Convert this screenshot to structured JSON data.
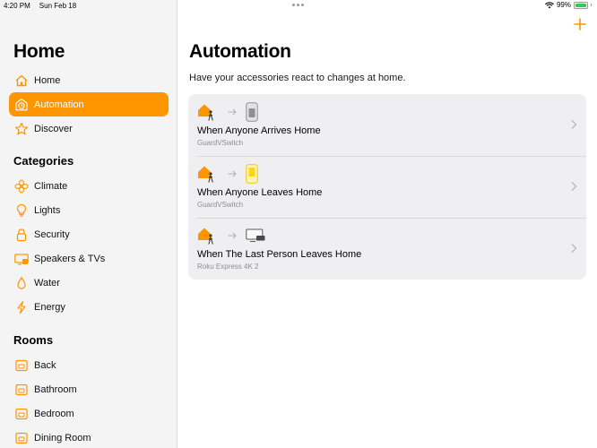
{
  "status_bar": {
    "time": "4:20 PM",
    "date": "Sun Feb 18",
    "battery": "99%"
  },
  "sidebar": {
    "title": "Home",
    "primary": [
      {
        "label": "Home",
        "icon": "house-icon",
        "selected": false
      },
      {
        "label": "Automation",
        "icon": "clock-icon",
        "selected": true
      },
      {
        "label": "Discover",
        "icon": "star-icon",
        "selected": false
      }
    ],
    "categories_header": "Categories",
    "categories": [
      {
        "label": "Climate",
        "icon": "fan-icon"
      },
      {
        "label": "Lights",
        "icon": "lightbulb-icon"
      },
      {
        "label": "Security",
        "icon": "lock-icon"
      },
      {
        "label": "Speakers & TVs",
        "icon": "tv-icon"
      },
      {
        "label": "Water",
        "icon": "drop-icon"
      },
      {
        "label": "Energy",
        "icon": "bolt-icon"
      }
    ],
    "rooms_header": "Rooms",
    "rooms": [
      {
        "label": "Back",
        "icon": "room-icon"
      },
      {
        "label": "Bathroom",
        "icon": "room-icon"
      },
      {
        "label": "Bedroom",
        "icon": "room-icon"
      },
      {
        "label": "Dining Room",
        "icon": "room-icon"
      }
    ]
  },
  "main": {
    "title": "Automation",
    "subtitle": "Have your accessories react to changes at home.",
    "automations": [
      {
        "title": "When Anyone Arrives Home",
        "subtitle": "GuardVSwitch",
        "target_icon": "switch-off-icon"
      },
      {
        "title": "When Anyone Leaves Home",
        "subtitle": "GuardVSwitch",
        "target_icon": "switch-on-icon"
      },
      {
        "title": "When The Last Person Leaves Home",
        "subtitle": "Roku Express 4K 2",
        "target_icon": "tv-box-icon"
      }
    ]
  },
  "colors": {
    "accent": "#ff9500",
    "sidebar_bg": "#f4f4f5",
    "card_bg": "#efeff2",
    "secondary_text": "#8e8e93"
  }
}
